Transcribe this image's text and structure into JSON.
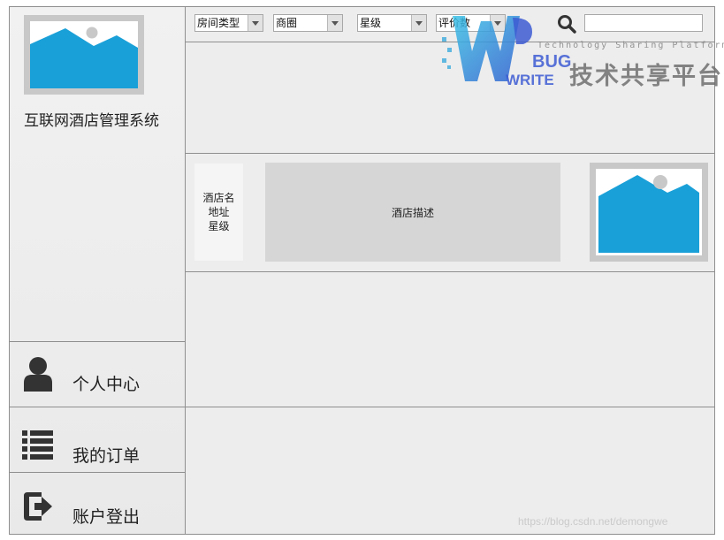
{
  "app": {
    "title": "互联网酒店管理系统"
  },
  "filters": [
    {
      "label": "房间类型"
    },
    {
      "label": "商圈"
    },
    {
      "label": "星级"
    },
    {
      "label": "评价数"
    }
  ],
  "search": {
    "value": "",
    "placeholder": ""
  },
  "hotel_card": {
    "name": "酒店名",
    "address": "地址",
    "star": "星级",
    "description": "酒店描述"
  },
  "nav": {
    "profile": "个人中心",
    "orders": "我的订单",
    "logout": "账户登出"
  },
  "watermark": {
    "tagline": "Technology Sharing Platform",
    "brand_bug": "BUG",
    "brand_write": "WRITE",
    "brand_cn": "技术共享平台",
    "url": "https://blog.csdn.net/demongwe"
  },
  "colors": {
    "image_placeholder_blue": "#1aa0d8",
    "panel_gray": "#ededed",
    "border_gray": "#8f8f8f"
  },
  "icons": {
    "logo": "image-placeholder-icon",
    "profile": "user-icon",
    "orders": "list-icon",
    "logout": "logout-icon",
    "search": "search-icon"
  }
}
